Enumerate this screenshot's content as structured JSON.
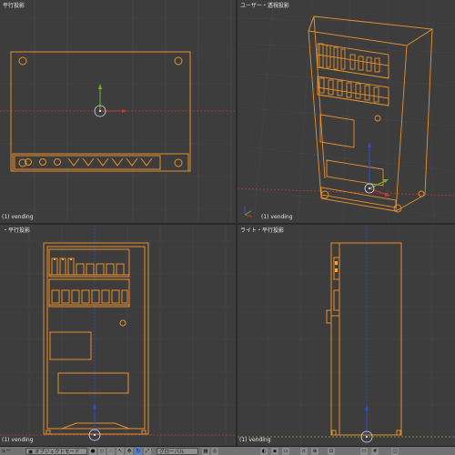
{
  "viewports": {
    "top_left": {
      "title": "平行投影",
      "object": "(1) vending"
    },
    "top_right": {
      "title": "ユーザー・透視投影",
      "object": "(1) vending"
    },
    "bottom_left": {
      "title": "・平行投影",
      "object": "(1) vending"
    },
    "bottom_right": {
      "title": "ライト・平行投影",
      "object": "(1) vending"
    }
  },
  "header": {
    "editor_icon": "view3d-icon",
    "left_label": "ュー",
    "mode_select": "オブジェクトモード",
    "pivot_label": "グローバル"
  },
  "colors": {
    "wire_selected": "#e8902a",
    "wire_active": "#f5a53c",
    "viewport_bg": "#3d3d3d",
    "grid_line": "#474747",
    "x_axis": "#c83a3a",
    "y_axis": "#6ab82a",
    "z_axis": "#2a4ed6"
  }
}
